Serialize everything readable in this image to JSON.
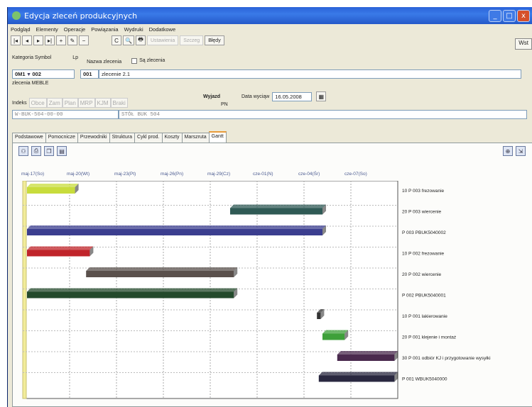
{
  "window": {
    "title": "Edycja zleceń produkcyjnych",
    "close_glyph": "x",
    "minimize_glyph": "_",
    "maximize_glyph": "□"
  },
  "menu": [
    "Podgląd",
    "Elementy",
    "Operacje",
    "Powiązania",
    "Wydruki",
    "Dodatkowe"
  ],
  "toolbar": {
    "first": "|◂",
    "prev": "◂",
    "next": "▸",
    "last": "▸|",
    "add": "+",
    "edit": "✎",
    "delete": "−",
    "refresh": "C",
    "search": "🔍",
    "print": "🖶",
    "disabled_1": "Ustawienia",
    "disabled_2": "Szczeg",
    "errors": "Błędy"
  },
  "wst_button": "Wst",
  "header": {
    "kategoria_label": "Kategoria Symbol",
    "lp_label": "Lp",
    "nazwa_label": "Nazwa zlecenia",
    "sa_zlecenia_label": "Są zlecenia",
    "kategoria_value": "0M1",
    "symbol_value": "002",
    "lp_value": "001",
    "nazwa_value": "zlecenie 2.1",
    "zlecenia_meble": "zlecenia MEBLE",
    "wyjazd_label": "Wyjazd",
    "data_label": "Data wyciąw",
    "data_value": "16.05.2008",
    "pn_label": "PN",
    "indeks_label": "Indeks",
    "indeks_buttons": [
      "Obce",
      "Zam",
      "Plan",
      "MRP",
      "KJM",
      "Braki"
    ],
    "indeks_value": "W-BUK-504-00-00",
    "indeks_name": "STÓŁ BUK 504"
  },
  "tabs": [
    "Podstawowe",
    "Pomocnicze",
    "Przewodniki",
    "Struktura",
    "Cykl prod.",
    "Koszty",
    "Marszruta",
    "Gantt"
  ],
  "active_tab": "Gantt",
  "gantt_tools": [
    "binoculars-icon",
    "printer-icon",
    "copy-icon",
    "save-icon"
  ],
  "gantt_right_tools": [
    "zoom-icon",
    "export-icon"
  ],
  "dates": [
    "maj-17(So)",
    "maj-20(Wt)",
    "maj-23(Pt)",
    "maj-26(Pn)",
    "maj-29(Cz)",
    "cze-01(N)",
    "cze-04(Śr)",
    "cze-07(So)"
  ],
  "tasks": [
    {
      "label": "10 P 003 frezowanie",
      "start": 0.0,
      "end": 0.13,
      "color": "#c8dc3c"
    },
    {
      "label": "20 P 003 wiercenie",
      "start": 0.55,
      "end": 0.8,
      "color": "#2f5a55"
    },
    {
      "label": "P 003 PBUK5040002",
      "start": 0.0,
      "end": 0.8,
      "color": "#3b3e8f"
    },
    {
      "label": "10 P 002 frezowanie",
      "start": 0.0,
      "end": 0.17,
      "color": "#c0242a"
    },
    {
      "label": "20 P 002 wiercenie",
      "start": 0.16,
      "end": 0.56,
      "color": "#5a504c"
    },
    {
      "label": "P 002 PBUK5040001",
      "start": 0.0,
      "end": 0.56,
      "color": "#244a2c"
    },
    {
      "label": "10 P 001 lakierowanie",
      "start": 0.785,
      "end": 0.795,
      "color": "#333333"
    },
    {
      "label": "20 P 001 klejenie i montaż",
      "start": 0.8,
      "end": 0.86,
      "color": "#3ea03a"
    },
    {
      "label": "30 P 001 odbiór KJ i przygotowanie wysyłki",
      "start": 0.84,
      "end": 0.995,
      "color": "#4a2a4e"
    },
    {
      "label": "P 001 WBUK5040000",
      "start": 0.79,
      "end": 0.995,
      "color": "#2a2840"
    }
  ]
}
